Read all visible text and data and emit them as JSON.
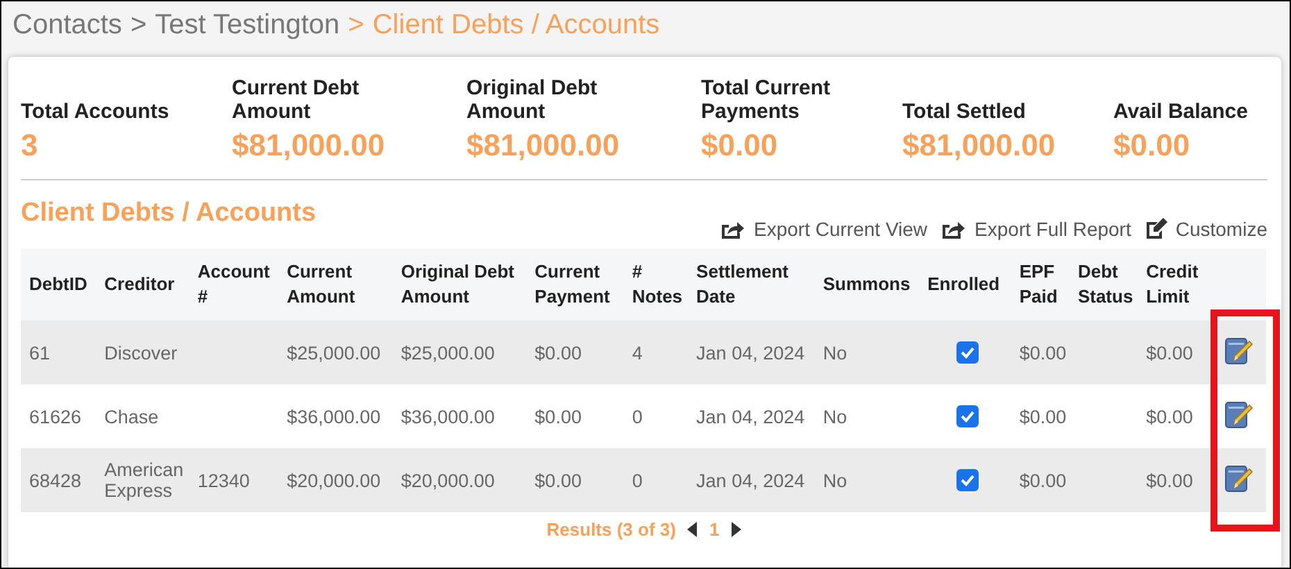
{
  "breadcrumb_separator": ">",
  "breadcrumb": [
    {
      "label": "Contacts",
      "current": false
    },
    {
      "label": "Test Testington",
      "current": false
    },
    {
      "label": "Client Debts / Accounts",
      "current": true
    }
  ],
  "summary": [
    {
      "label": "Total Accounts",
      "value": "3"
    },
    {
      "label": "Current Debt Amount",
      "value": "$81,000.00"
    },
    {
      "label": "Original Debt Amount",
      "value": "$81,000.00"
    },
    {
      "label": "Total Current Payments",
      "value": "$0.00"
    },
    {
      "label": "Total Settled",
      "value": "$81,000.00"
    },
    {
      "label": "Avail Balance",
      "value": "$0.00"
    }
  ],
  "section_title": "Client Debts / Accounts",
  "actions": [
    {
      "label": "Export Current View",
      "kind": "export"
    },
    {
      "label": "Export Full Report",
      "kind": "export"
    },
    {
      "label": "Customize",
      "kind": "customize"
    }
  ],
  "table": {
    "columns": [
      "DebtID",
      "Creditor",
      "Account #",
      "Current Amount",
      "Original Debt Amount",
      "Current Payment",
      "# Notes",
      "Settlement Date",
      "Summons",
      "Enrolled",
      "EPF Paid",
      "Debt Status",
      "Credit Limit"
    ],
    "rows": [
      {
        "debt_id": "61",
        "creditor": "Discover",
        "current_amount": "$25,000.00",
        "original_amount": "$25,000.00",
        "current_payment": "$0.00",
        "notes": "4",
        "settlement_date": "Jan 04, 2024",
        "summons": "No",
        "enrolled": true,
        "epf_paid": "$0.00",
        "credit_limit": "$0.00"
      },
      {
        "debt_id": "61626",
        "creditor": "Chase",
        "current_amount": "$36,000.00",
        "original_amount": "$36,000.00",
        "current_payment": "$0.00",
        "notes": "0",
        "settlement_date": "Jan 04, 2024",
        "summons": "No",
        "enrolled": true,
        "epf_paid": "$0.00",
        "credit_limit": "$0.00"
      },
      {
        "debt_id": "68428",
        "creditor": "American Express",
        "account": "12340",
        "current_amount": "$20,000.00",
        "original_amount": "$20,000.00",
        "current_payment": "$0.00",
        "notes": "0",
        "settlement_date": "Jan 04, 2024",
        "summons": "No",
        "enrolled": true,
        "epf_paid": "$0.00",
        "credit_limit": "$0.00"
      }
    ]
  },
  "pagination": {
    "results": "Results (3 of 3)",
    "pages": [
      {
        "label": "1",
        "selected": true
      }
    ]
  },
  "edit_column_highlighted": true
}
